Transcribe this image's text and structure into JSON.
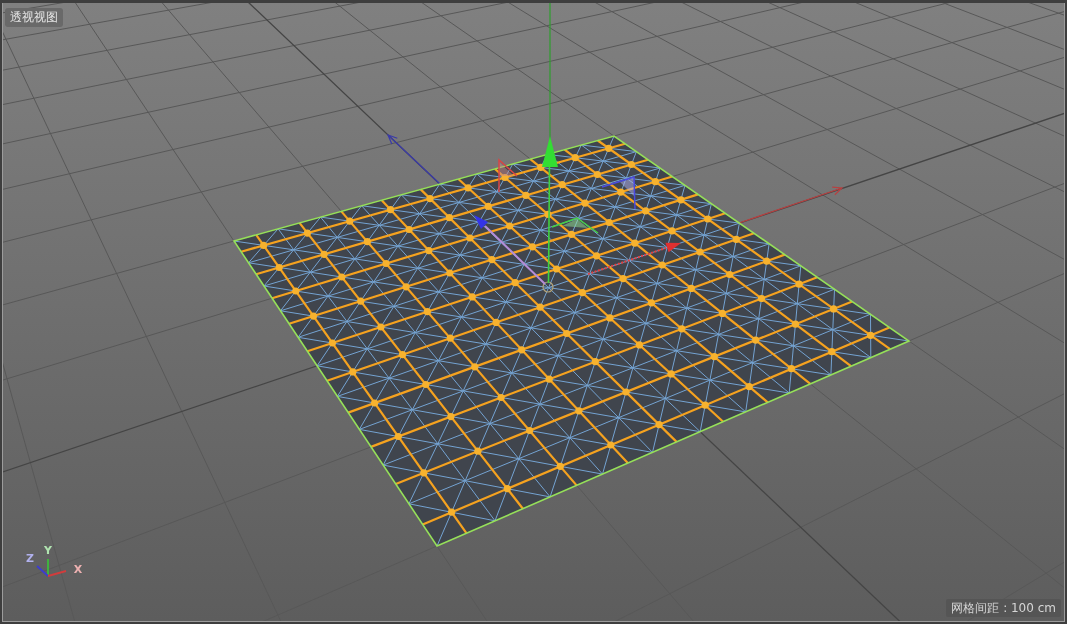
{
  "viewport": {
    "title": "透视视图",
    "grid_spacing": "网格间距 : 100 cm"
  },
  "axis_triad": [
    {
      "label": "Y",
      "color": "#3cbc3c"
    },
    {
      "label": "Z",
      "color": "#3c3cd2"
    },
    {
      "label": "X",
      "color": "#d23c3c"
    }
  ]
}
